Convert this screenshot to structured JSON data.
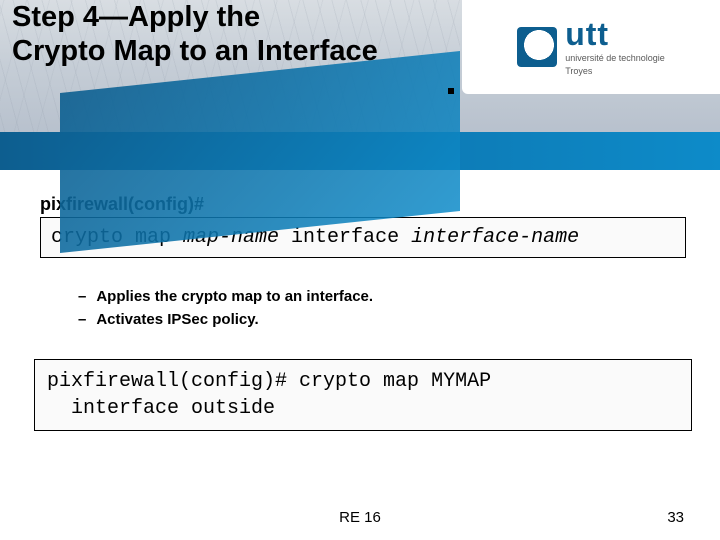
{
  "header": {
    "title_line1": "Step 4—Apply the",
    "title_line2": "Crypto Map to an Interface",
    "logo": {
      "name": "utt",
      "subtitle": "université de technologie",
      "city": "Troyes"
    }
  },
  "content": {
    "prompt": "pixfirewall(config)#",
    "syntax_cmd_prefix": "crypto map ",
    "syntax_param1": "map-name",
    "syntax_mid": " interface ",
    "syntax_param2": "interface-name",
    "bullets": [
      "Applies the crypto map to an interface.",
      "Activates IPSec policy."
    ],
    "example_line1": "pixfirewall(config)# crypto map MYMAP",
    "example_line2": "  interface outside"
  },
  "footer": {
    "code": "RE 16",
    "page": "33"
  }
}
